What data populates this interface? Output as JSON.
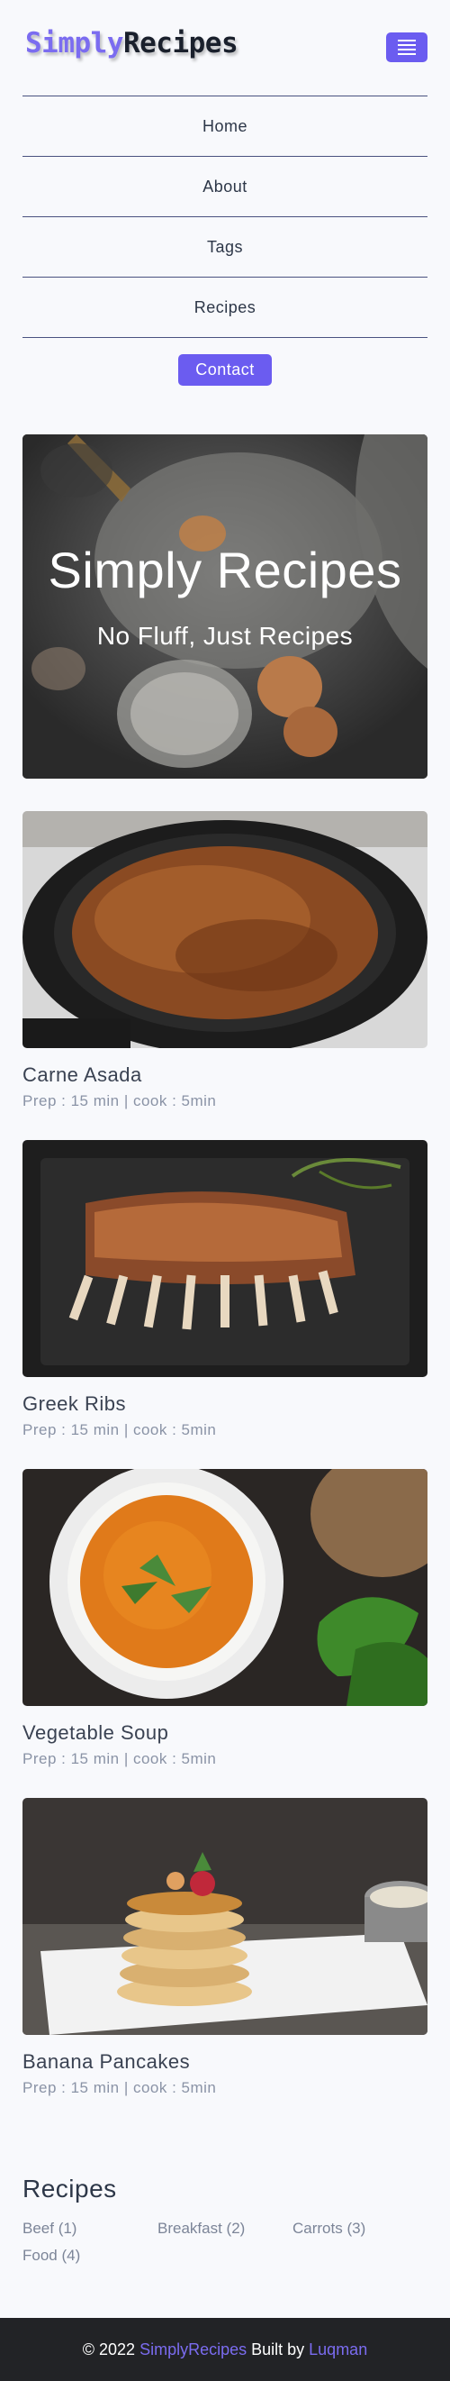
{
  "header": {
    "logo_part1": "Simply",
    "logo_part2": "Recipes",
    "menu_icon": "hamburger-menu-icon"
  },
  "nav": {
    "items": [
      "Home",
      "About",
      "Tags",
      "Recipes"
    ],
    "contact_label": "Contact"
  },
  "hero": {
    "title": "Simply Recipes",
    "subtitle": "No Fluff, Just Recipes"
  },
  "recipes": [
    {
      "name": "Carne Asada",
      "meta": "Prep : 15 min | cook : 5min"
    },
    {
      "name": "Greek Ribs",
      "meta": "Prep : 15 min | cook : 5min"
    },
    {
      "name": "Vegetable Soup",
      "meta": "Prep : 15 min | cook : 5min"
    },
    {
      "name": "Banana Pancakes",
      "meta": "Prep : 15 min | cook : 5min"
    }
  ],
  "tags_section": {
    "title": "Recipes",
    "tags": [
      "Beef (1)",
      "Breakfast (2)",
      "Carrots (3)",
      "Food (4)"
    ]
  },
  "footer": {
    "prefix": "© 2022",
    "brand": "SimplyRecipes",
    "built_by": "Built by",
    "author": "Luqman"
  },
  "colors": {
    "accent": "#6b5cf0",
    "footer_bg": "#222326",
    "page_bg": "#f8f9fc"
  }
}
